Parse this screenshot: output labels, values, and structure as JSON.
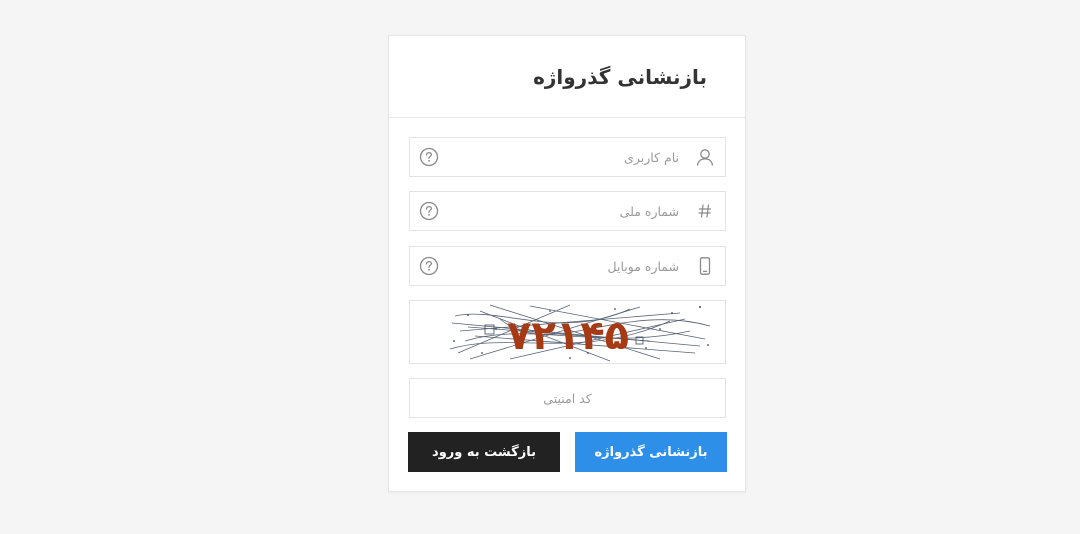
{
  "form": {
    "title": "بازنشانی گذرواژه",
    "fields": [
      {
        "placeholder": "نام کاربری",
        "icon": "user-icon"
      },
      {
        "placeholder": "شماره ملی",
        "icon": "hash-icon"
      },
      {
        "placeholder": "شماره موبایل",
        "icon": "mobile-icon"
      }
    ],
    "captcha_text": "۷۲۱۴۵",
    "security_code_placeholder": "کد امنیتی",
    "submit_label": "بازنشانی گذرواژه",
    "back_label": "بازگشت به ورود"
  },
  "colors": {
    "primary": "#2d8fe8",
    "dark": "#222222",
    "captcha_text": "#a53a14",
    "page_background": "#f5f5f5"
  }
}
